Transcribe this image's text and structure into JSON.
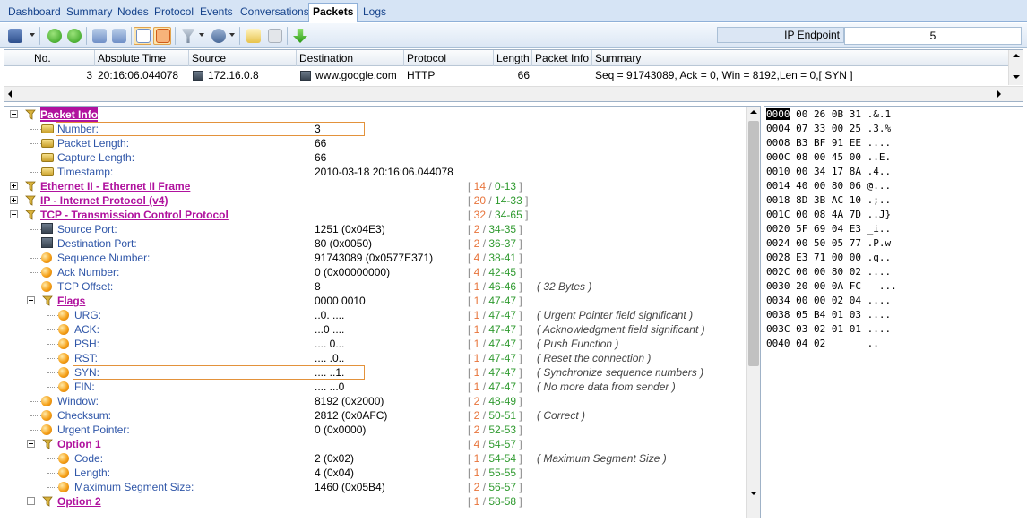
{
  "tabs": [
    "Dashboard",
    "Summary",
    "Nodes",
    "Protocol",
    "Events",
    "Conversations",
    "Packets",
    "Logs"
  ],
  "active_tab": "Packets",
  "toolbar": {
    "ip_endpoint_label": "IP Endpoint",
    "ip_endpoint_value": "5"
  },
  "packet_list": {
    "columns": [
      "No.",
      "Absolute Time",
      "Source",
      "Destination",
      "Protocol",
      "Length",
      "Packet Info",
      "Summary"
    ],
    "rows": [
      {
        "no": "3",
        "time": "20:16:06.044078",
        "source": "172.16.0.8",
        "destination": "www.google.com",
        "protocol": "HTTP",
        "length": "66",
        "info": "",
        "summary": "Seq = 91743089, Ack = 0, Win = 8192,Len = 0,[ SYN ]"
      }
    ]
  },
  "tree": [
    {
      "label": "Packet Info",
      "kind": "link",
      "selected": true,
      "expander": "minus",
      "icon": "folder",
      "value": "",
      "off_a": "",
      "off_b": "",
      "note": ""
    },
    {
      "label": "Number:",
      "kind": "leaf",
      "icon": "db",
      "value": "3",
      "off_a": "",
      "off_b": "",
      "note": "",
      "boxed": true
    },
    {
      "label": "Packet Length:",
      "kind": "leaf",
      "icon": "db",
      "value": "66",
      "off_a": "",
      "off_b": "",
      "note": ""
    },
    {
      "label": "Capture Length:",
      "kind": "leaf",
      "icon": "db",
      "value": "66",
      "off_a": "",
      "off_b": "",
      "note": ""
    },
    {
      "label": "Timestamp:",
      "kind": "leaf",
      "icon": "db",
      "value": "2010-03-18 20:16:06.044078",
      "off_a": "",
      "off_b": "",
      "note": ""
    },
    {
      "label": "Ethernet II - Ethernet II Frame",
      "kind": "link",
      "expander": "plus",
      "icon": "folder",
      "value": "",
      "off_a": "14",
      "off_b": "0-13",
      "note": ""
    },
    {
      "label": "IP - Internet Protocol (v4)",
      "kind": "link",
      "expander": "plus",
      "icon": "folder",
      "value": "",
      "off_a": "20",
      "off_b": "14-33",
      "note": ""
    },
    {
      "label": "TCP - Transmission Control Protocol",
      "kind": "link",
      "expander": "minus",
      "icon": "folder",
      "value": "",
      "off_a": "32",
      "off_b": "34-65",
      "note": ""
    },
    {
      "label": "Source Port:",
      "kind": "leaf",
      "icon": "pc",
      "value": "1251 (0x04E3)",
      "off_a": "2",
      "off_b": "34-35",
      "note": ""
    },
    {
      "label": "Destination Port:",
      "kind": "leaf",
      "icon": "pc",
      "value": "80 (0x0050)",
      "off_a": "2",
      "off_b": "36-37",
      "note": ""
    },
    {
      "label": "Sequence Number:",
      "kind": "leaf",
      "icon": "ball",
      "value": "91743089 (0x0577E371)",
      "off_a": "4",
      "off_b": "38-41",
      "note": ""
    },
    {
      "label": "Ack Number:",
      "kind": "leaf",
      "icon": "ball",
      "value": "0 (0x00000000)",
      "off_a": "4",
      "off_b": "42-45",
      "note": ""
    },
    {
      "label": "TCP Offset:",
      "kind": "leaf",
      "icon": "ball",
      "value": "8",
      "off_a": "1",
      "off_b": "46-46",
      "note": "( 32 Bytes )"
    },
    {
      "label": "Flags",
      "kind": "link",
      "expander": "minus",
      "icon": "folder",
      "value": "0000 0010",
      "off_a": "1",
      "off_b": "47-47",
      "note": ""
    },
    {
      "label": "URG:",
      "kind": "leaf",
      "icon": "ball",
      "value": "..0. ....",
      "off_a": "1",
      "off_b": "47-47",
      "note": "( Urgent Pointer field significant )"
    },
    {
      "label": "ACK:",
      "kind": "leaf",
      "icon": "ball",
      "value": "...0 ....",
      "off_a": "1",
      "off_b": "47-47",
      "note": "( Acknowledgment field significant )"
    },
    {
      "label": "PSH:",
      "kind": "leaf",
      "icon": "ball",
      "value": ".... 0...",
      "off_a": "1",
      "off_b": "47-47",
      "note": "( Push Function )"
    },
    {
      "label": "RST:",
      "kind": "leaf",
      "icon": "ball",
      "value": ".... .0..",
      "off_a": "1",
      "off_b": "47-47",
      "note": "( Reset the connection )"
    },
    {
      "label": "SYN:",
      "kind": "leaf",
      "icon": "ball",
      "value": ".... ..1.",
      "off_a": "1",
      "off_b": "47-47",
      "note": "( Synchronize sequence numbers )",
      "boxed": true
    },
    {
      "label": "FIN:",
      "kind": "leaf",
      "icon": "ball",
      "value": ".... ...0",
      "off_a": "1",
      "off_b": "47-47",
      "note": "( No more data from sender )"
    },
    {
      "label": "Window:",
      "kind": "leaf",
      "icon": "ball",
      "value": "8192 (0x2000)",
      "off_a": "2",
      "off_b": "48-49",
      "note": ""
    },
    {
      "label": "Checksum:",
      "kind": "leaf",
      "icon": "ball",
      "value": "2812 (0x0AFC)",
      "off_a": "2",
      "off_b": "50-51",
      "note": "( Correct )"
    },
    {
      "label": "Urgent Pointer:",
      "kind": "leaf",
      "icon": "ball",
      "value": "0 (0x0000)",
      "off_a": "2",
      "off_b": "52-53",
      "note": ""
    },
    {
      "label": "Option 1",
      "kind": "link",
      "expander": "minus",
      "icon": "folder",
      "value": "",
      "off_a": "4",
      "off_b": "54-57",
      "note": ""
    },
    {
      "label": "Code:",
      "kind": "leaf",
      "icon": "ball",
      "value": "2 (0x02)",
      "off_a": "1",
      "off_b": "54-54",
      "note": "( Maximum Segment Size )"
    },
    {
      "label": "Length:",
      "kind": "leaf",
      "icon": "ball",
      "value": "4 (0x04)",
      "off_a": "1",
      "off_b": "55-55",
      "note": ""
    },
    {
      "label": "Maximum Segment Size:",
      "kind": "leaf",
      "icon": "ball",
      "value": "1460 (0x05B4)",
      "off_a": "2",
      "off_b": "56-57",
      "note": ""
    },
    {
      "label": "Option 2",
      "kind": "link",
      "expander": "minus",
      "icon": "folder",
      "value": "",
      "off_a": "1",
      "off_b": "58-58",
      "note": ""
    }
  ],
  "hex": [
    {
      "addr": "0000",
      "bytes": "00 26 0B 31",
      "ascii": ".&.1",
      "selected": true
    },
    {
      "addr": "0004",
      "bytes": "07 33 00 25",
      "ascii": ".3.%"
    },
    {
      "addr": "0008",
      "bytes": "B3 BF 91 EE",
      "ascii": "...."
    },
    {
      "addr": "000C",
      "bytes": "08 00 45 00",
      "ascii": "..E."
    },
    {
      "addr": "0010",
      "bytes": "00 34 17 8A",
      "ascii": ".4.."
    },
    {
      "addr": "0014",
      "bytes": "40 00 80 06",
      "ascii": "@..."
    },
    {
      "addr": "0018",
      "bytes": "8D 3B AC 10",
      "ascii": ".;.."
    },
    {
      "addr": "001C",
      "bytes": "00 08 4A 7D",
      "ascii": "..J}"
    },
    {
      "addr": "0020",
      "bytes": "5F 69 04 E3",
      "ascii": "_i.."
    },
    {
      "addr": "0024",
      "bytes": "00 50 05 77",
      "ascii": ".P.w"
    },
    {
      "addr": "0028",
      "bytes": "E3 71 00 00",
      "ascii": ".q.."
    },
    {
      "addr": "002C",
      "bytes": "00 00 80 02",
      "ascii": "...."
    },
    {
      "addr": "0030",
      "bytes": "20 00 0A FC",
      "ascii": "  ..."
    },
    {
      "addr": "0034",
      "bytes": "00 00 02 04",
      "ascii": "...."
    },
    {
      "addr": "0038",
      "bytes": "05 B4 01 03",
      "ascii": "...."
    },
    {
      "addr": "003C",
      "bytes": "03 02 01 01",
      "ascii": "...."
    },
    {
      "addr": "0040",
      "bytes": "04 02      ",
      "ascii": ".."
    }
  ]
}
